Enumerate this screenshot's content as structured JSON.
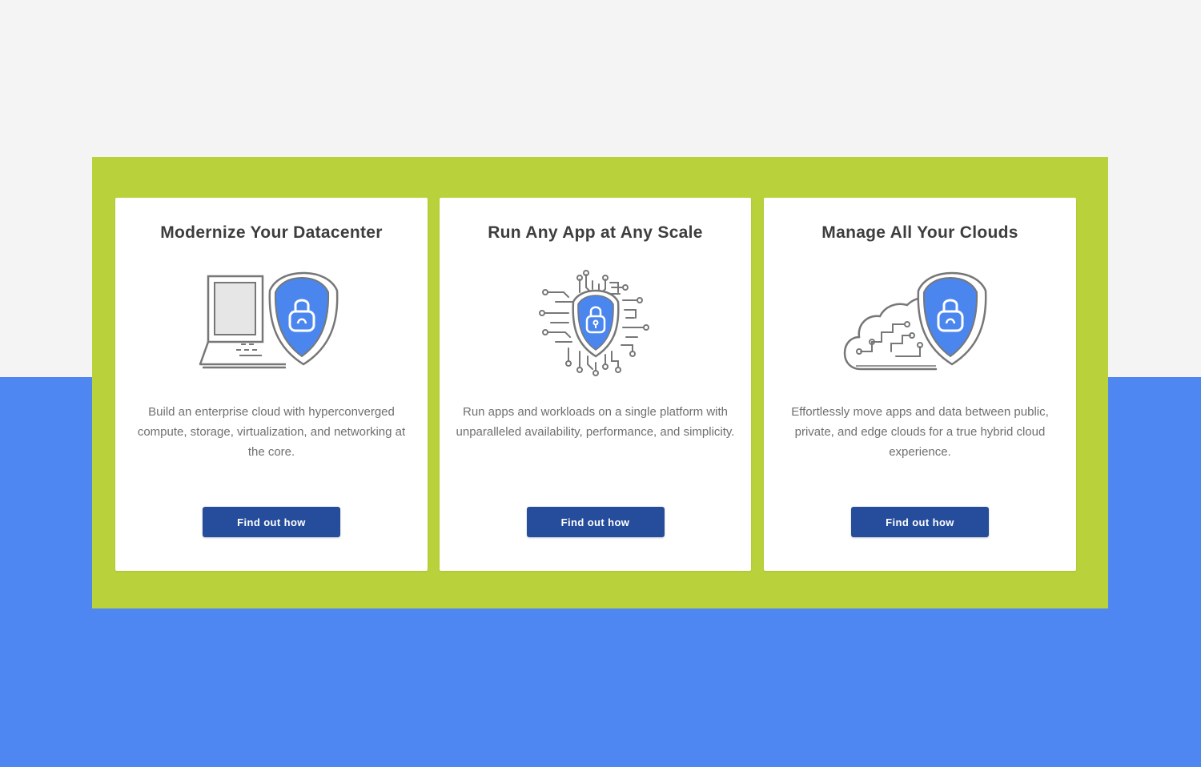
{
  "colors": {
    "page_background_top": "#f4f4f4",
    "page_background_bottom": "#4f87f2",
    "panel_background": "#b9d13a",
    "card_background": "#ffffff",
    "button_background": "#264d9c",
    "button_text": "#ffffff",
    "icon_accent": "#4a86ee",
    "icon_stroke": "#777777"
  },
  "cards": [
    {
      "title": "Modernize Your Datacenter",
      "icon": "laptop-shield-lock-icon",
      "description": "Build an enterprise cloud with hyperconverged compute, storage, virtualization, and networking at the core.",
      "button_label": "Find out how"
    },
    {
      "title": "Run Any App at Any Scale",
      "icon": "circuit-shield-lock-icon",
      "description": "Run apps and workloads on a single platform with unparalleled availability, performance, and simplicity.",
      "button_label": "Find out how"
    },
    {
      "title": "Manage All Your Clouds",
      "icon": "cloud-shield-lock-icon",
      "description": "Effortlessly move apps and data between public, private, and edge clouds for a true hybrid cloud experience.",
      "button_label": "Find out how"
    }
  ]
}
